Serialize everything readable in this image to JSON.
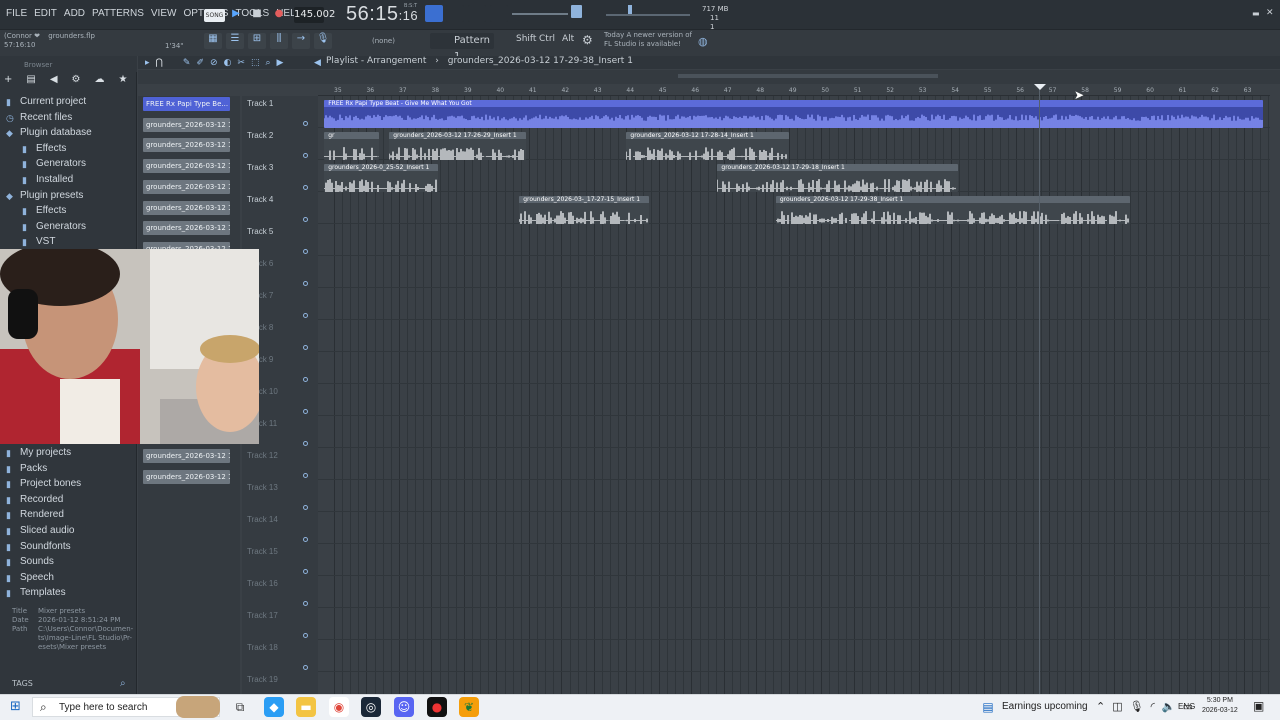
{
  "menu": [
    "FILE",
    "EDIT",
    "ADD",
    "PATTERNS",
    "VIEW",
    "OPTIONS",
    "TOOLS",
    "HELP"
  ],
  "transport": {
    "mode_label": "SONG",
    "tempo": "145.002",
    "time": "56:15",
    "time_sub": ":16",
    "time_top": "B:S:T",
    "ram": "717 MB",
    "ram_sub": "11",
    "ram_sub2": "1"
  },
  "project": {
    "user": "(Connor ❤",
    "file": "grounders.flp",
    "time": "57:16:10",
    "hint": "1'34\""
  },
  "toolbar2": {
    "preset": "(none)",
    "pattern": "Pattern 1",
    "keys": [
      "Shift",
      "Ctrl",
      "Alt"
    ],
    "news_line1": "Today A newer version of",
    "news_line2": "FL Studio is available!"
  },
  "browser": {
    "header": "Browser",
    "items": [
      {
        "label": "Current project",
        "icon": "folder-icon"
      },
      {
        "label": "Recent files",
        "icon": "clock-icon"
      },
      {
        "label": "Plugin database",
        "icon": "plug-icon"
      },
      {
        "label": "Effects",
        "icon": "folder-icon",
        "indent": true
      },
      {
        "label": "Generators",
        "icon": "folder-icon",
        "indent": true
      },
      {
        "label": "Installed",
        "icon": "folder-icon",
        "indent": true
      },
      {
        "label": "Plugin presets",
        "icon": "plug-icon"
      },
      {
        "label": "Effects",
        "icon": "folder-icon",
        "indent": true
      },
      {
        "label": "Generators",
        "icon": "folder-icon",
        "indent": true
      },
      {
        "label": "VST",
        "icon": "folder-icon",
        "indent": true
      }
    ],
    "items2": [
      {
        "label": "My projects",
        "icon": "folder-icon"
      },
      {
        "label": "Packs",
        "icon": "folder-icon"
      },
      {
        "label": "Project bones",
        "icon": "folder-icon"
      },
      {
        "label": "Recorded",
        "icon": "folder-icon"
      },
      {
        "label": "Rendered",
        "icon": "folder-icon"
      },
      {
        "label": "Sliced audio",
        "icon": "folder-icon"
      },
      {
        "label": "Soundfonts",
        "icon": "folder-icon"
      },
      {
        "label": "Sounds",
        "icon": "folder-icon"
      },
      {
        "label": "Speech",
        "icon": "folder-icon"
      },
      {
        "label": "Templates",
        "icon": "folder-icon"
      }
    ],
    "meta": {
      "title_label": "Title",
      "title": "Mixer presets",
      "date_label": "Date",
      "date": "2026-01-12 8:51:24 PM",
      "path_label": "Path",
      "path1": "C:\\Users\\Connor\\Documen-",
      "path2": "ts\\Image-Line\\FL Studio\\Pr-",
      "path3": "esets\\Mixer presets"
    },
    "tags": "TAGS"
  },
  "clips_column": [
    "FREE Rx Papi Type Be...",
    "grounders_2026-03-12 1...",
    "grounders_2026-03-12 1...",
    "grounders_2026-03-12 1...",
    "grounders_2026-03-12 1...",
    "grounders_2026-03-12 1...",
    "grounders_2026-03-12 1...",
    "grounders_2026-03-12 1...",
    "grounders_2026-03-12 1...",
    "grounders_2026-03-12 1...",
    "grounders_2026-03-12 1...",
    "grounders_2026-03-12 1...",
    "grounders_2026-03-12 1...",
    "grounders_2026-03-12 1...",
    "grounders_2026-03-12 1...",
    "grounders_2026-03-12 1...",
    "grounders_2026-03-12 1...",
    "grounders_2026-03-12 1...",
    "grounders_2026-03-12 1..."
  ],
  "tracks": [
    "Track 1",
    "Track 2",
    "Track 3",
    "Track 4",
    "Track 5",
    "Track 6",
    "Track 7",
    "Track 8",
    "Track 9",
    "Track 10",
    "Track 11",
    "Track 12",
    "Track 13",
    "Track 14",
    "Track 15",
    "Track 16",
    "Track 17",
    "Track 18",
    "Track 19"
  ],
  "playlist": {
    "title": "Playlist - Arrangement",
    "pattern": "grounders_2026-03-12 17-29-38_Insert 1",
    "ruler_start": 35,
    "ruler_end": 63,
    "clips": [
      {
        "label": "FREE Rx Papi Type Beat - Give Me What You Got",
        "track": 1,
        "start": 35.1,
        "end": 64,
        "color": "#5c6bd9"
      },
      {
        "label": "gr",
        "track": 2,
        "start": 35.1,
        "end": 36.8,
        "color": "#707a84"
      },
      {
        "label": "grounders_2026-03-12 17-26-29_Insert 1",
        "track": 2,
        "start": 37.1,
        "end": 41.3,
        "color": "#707a84"
      },
      {
        "label": "grounders_2026-03-12 17-28-14_Insert 1",
        "track": 2,
        "start": 44.4,
        "end": 49.4,
        "color": "#707a84"
      },
      {
        "label": "grounders_2026-0_25-52_Insert 1",
        "track": 3,
        "start": 35.1,
        "end": 38.6,
        "color": "#707a84"
      },
      {
        "label": "grounders_2026-03-12 17-29-18_Insert 1",
        "track": 3,
        "start": 47.2,
        "end": 54.6,
        "color": "#707a84"
      },
      {
        "label": "grounders_2026-03-_17-27-15_Insert 1",
        "track": 4,
        "start": 41.1,
        "end": 45.1,
        "color": "#707a84"
      },
      {
        "label": "grounders_2026-03-12 17-29-38_Insert 1",
        "track": 4,
        "start": 49.0,
        "end": 59.9,
        "color": "#707a84"
      }
    ]
  },
  "taskbar": {
    "search_placeholder": "Type here to search",
    "news": "Earnings upcoming",
    "lang": "ENG",
    "time": "5:30 PM",
    "date": "2026-03-12"
  }
}
